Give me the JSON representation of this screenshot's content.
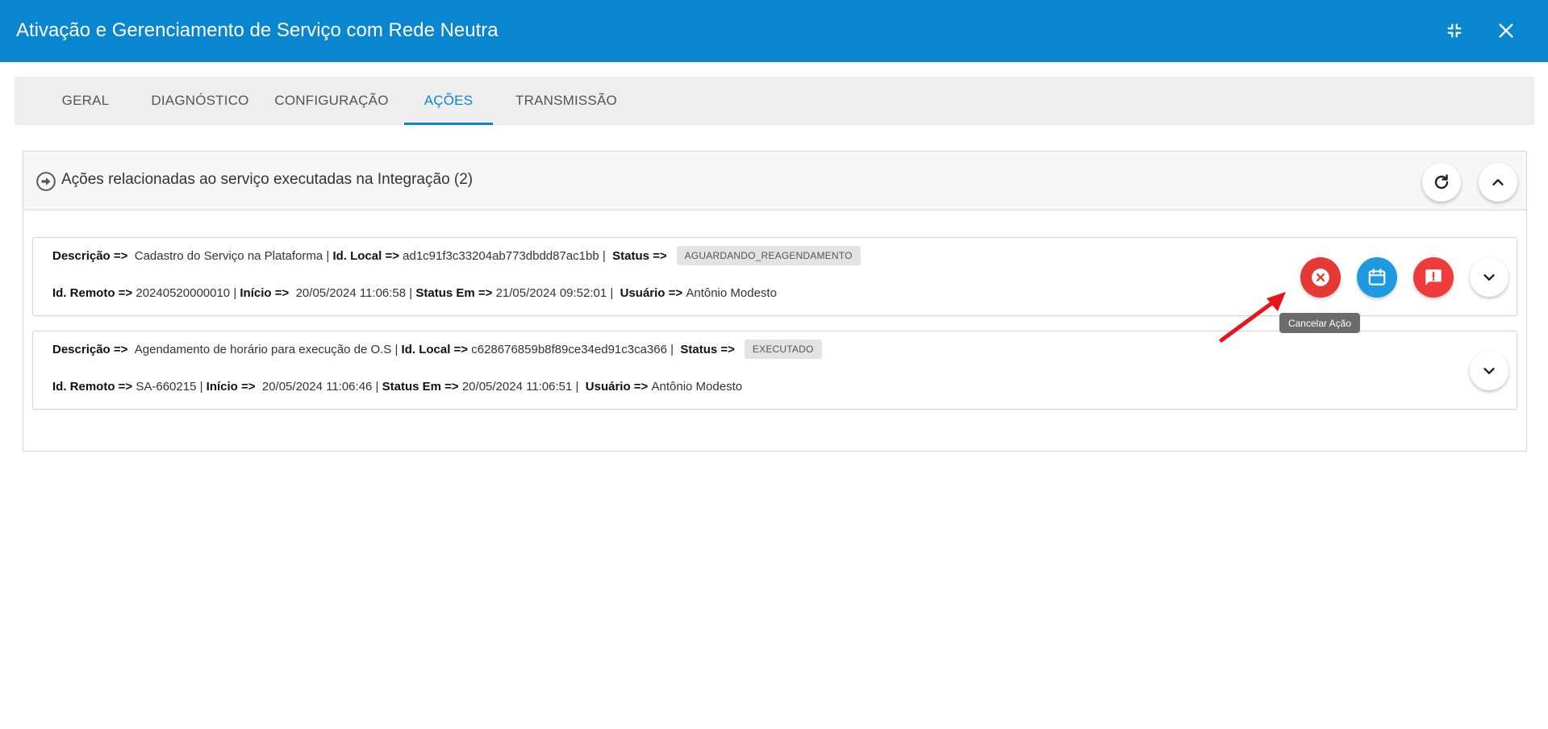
{
  "window": {
    "title": "Ativação e Gerenciamento de Serviço com Rede Neutra",
    "minimize_icon": "compress-icon",
    "close_icon": "close-icon"
  },
  "tabs": [
    {
      "label": "GERAL",
      "active": false
    },
    {
      "label": "DIAGNÓSTICO",
      "active": false
    },
    {
      "label": "CONFIGURAÇÃO",
      "active": false
    },
    {
      "label": "AÇÕES",
      "active": true
    },
    {
      "label": "TRANSMISSÃO",
      "active": false
    }
  ],
  "panel": {
    "title": "Ações relacionadas ao serviço executadas na Integração (2)",
    "icon": "arrow-circle-right-icon"
  },
  "labels": {
    "descricao": "Descrição =>",
    "id_local": "Id. Local =>",
    "status": "Status =>",
    "id_remoto": "Id. Remoto =>",
    "inicio": "Início =>",
    "status_em": "Status Em =>",
    "usuario": "Usuário =>"
  },
  "actions": [
    {
      "descricao": "Cadastro do Serviço na Plataforma",
      "id_local": "ad1c91f3c33204ab773dbdd87ac1bb",
      "status": "AGUARDANDO_REAGENDAMENTO",
      "id_remoto": "20240520000010",
      "inicio": "20/05/2024 11:06:58",
      "status_em": "21/05/2024 09:52:01",
      "usuario": "Antônio Modesto"
    },
    {
      "descricao": "Agendamento de horário para execução de O.S",
      "id_local": "c628676859b8f89ce34ed91c3ca366",
      "status": "EXECUTADO",
      "id_remoto": "SA-660215",
      "inicio": "20/05/2024 11:06:46",
      "status_em": "20/05/2024 11:06:51",
      "usuario": "Antônio Modesto"
    }
  ],
  "tooltip": "Cancelar Ação",
  "colors": {
    "primary": "#0a86d0",
    "cancel": "#e53935",
    "schedule": "#1e9be0",
    "report": "#ef3b3b",
    "annotation_arrow": "#e8141c"
  }
}
